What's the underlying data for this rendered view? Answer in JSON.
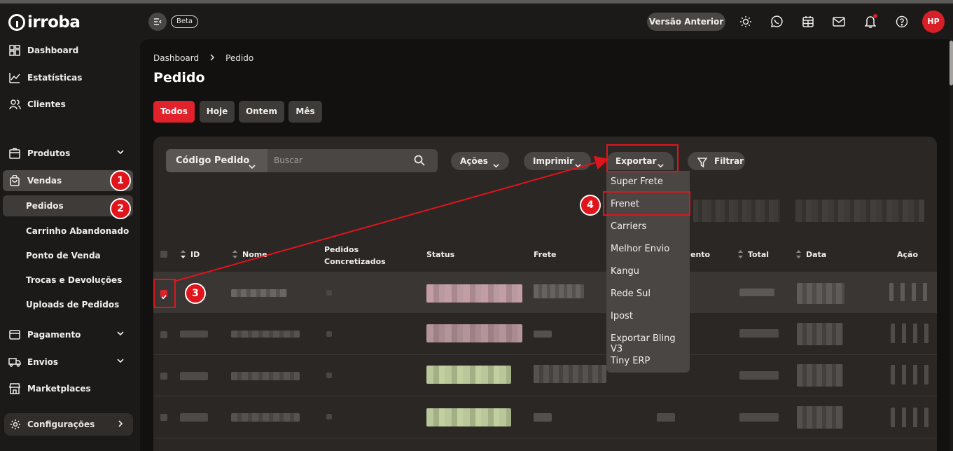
{
  "app": {
    "logo_text": "irroba"
  },
  "header": {
    "beta_label": "Beta",
    "previous_version_label": "Versão Anterior",
    "avatar_initials": "HP"
  },
  "sidebar": {
    "items": [
      {
        "label": "Dashboard",
        "icon": "dashboard-icon"
      },
      {
        "label": "Estatísticas",
        "icon": "stats-icon"
      },
      {
        "label": "Clientes",
        "icon": "users-icon"
      },
      {
        "label": "Produtos",
        "icon": "box-icon"
      },
      {
        "label": "Vendas",
        "icon": "bag-icon"
      },
      {
        "label": "Pagamento",
        "icon": "card-icon"
      },
      {
        "label": "Envios",
        "icon": "truck-icon"
      },
      {
        "label": "Marketplaces",
        "icon": "store-icon"
      }
    ],
    "vendas_sub": [
      "Pedidos",
      "Carrinho Abandonado",
      "Ponto de Venda",
      "Trocas e Devoluções",
      "Uploads de Pedidos"
    ],
    "config_label": "Configurações"
  },
  "page": {
    "breadcrumb": [
      "Dashboard",
      "Pedido"
    ],
    "title": "Pedido",
    "filters": [
      "Todos",
      "Hoje",
      "Ontem",
      "Mês"
    ],
    "active_filter": "Todos"
  },
  "toolbar": {
    "search_select": "Código Pedido",
    "search_placeholder": "Buscar",
    "actions_label": "Ações",
    "print_label": "Imprimir",
    "export_label": "Exportar",
    "filter_label": "Filtrar"
  },
  "export_menu": [
    "Super Frete",
    "Frenet",
    "Carriers",
    "Melhor Envio",
    "Kangu",
    "Rede Sul",
    "Ipost",
    "Exportar Bling V3",
    "Tiny ERP"
  ],
  "table": {
    "headers": {
      "id": "ID",
      "name": "Nome",
      "orders_line1": "Pedidos",
      "orders_line2": "Concretizados",
      "status": "Status",
      "shipping": "Frete",
      "payment_partial": "ento",
      "total": "Total",
      "date": "Data",
      "action": "Ação"
    }
  },
  "annotations": {
    "step1": "1",
    "step2": "2",
    "step3": "3",
    "step4": "4"
  },
  "colors": {
    "accent": "#e1222b",
    "annotation_red": "#e0141c",
    "panel": "#2a2725"
  }
}
